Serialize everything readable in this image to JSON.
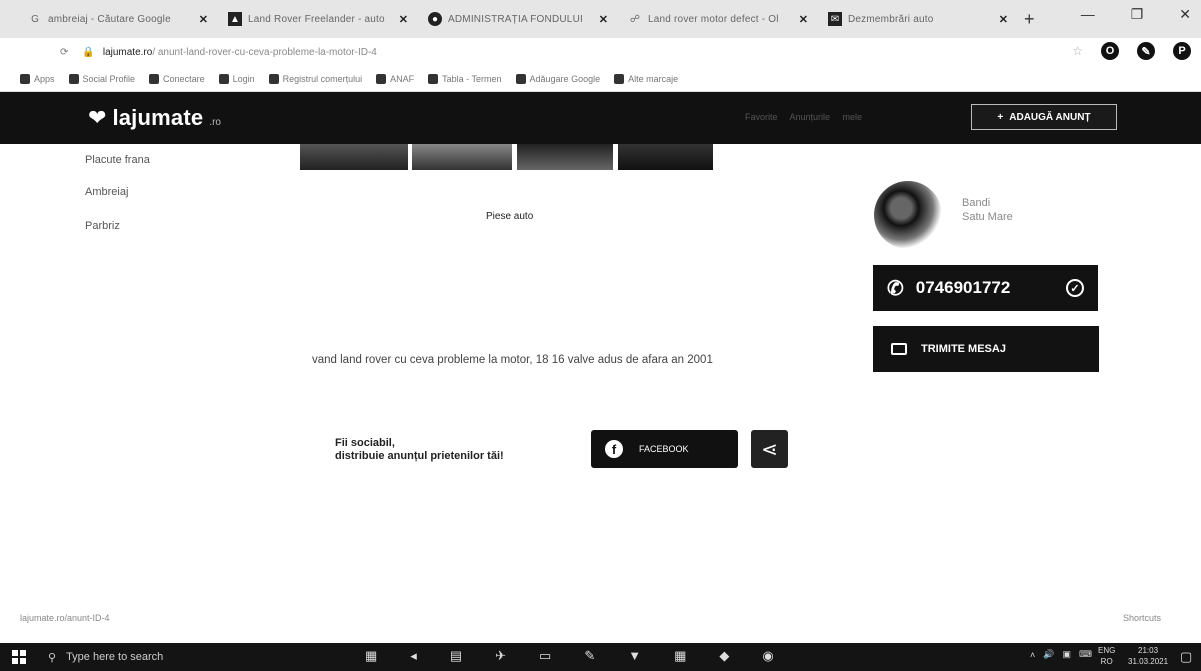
{
  "browser": {
    "tabs": [
      {
        "title": "ambreiaj - Căutare Google",
        "icon": "google-icon"
      },
      {
        "title": "Land Rover Freelander - auto",
        "icon": "site-icon"
      },
      {
        "title": "ADMINISTRAȚIA FONDULUI",
        "icon": "site-icon"
      },
      {
        "title": "Land rover motor defect - Ol",
        "icon": "site-icon"
      },
      {
        "title": "Dezmembrări auto",
        "icon": "site-icon"
      }
    ],
    "new_tab": "+",
    "url_domain": "lajumate.ro",
    "url_rest": "/ anunt-land-rover-cu-ceva-probleme-la-motor-ID-4",
    "bookmarks": [
      "Apps",
      "Social Profile",
      "Conectare",
      "Login",
      "Registrul comerțului",
      "ANAF",
      "Tabla - Termen",
      "Adăugare Google",
      "Alte marcaje"
    ],
    "profile_letter": "P"
  },
  "site": {
    "logo": "lajumate",
    "logo_tld": ".ro",
    "header_links": "Favorite   Anunțurile mele",
    "add_button": "ADAUGĂ ANUNȚ",
    "categories": [
      "Placute frana",
      "Ambreiaj",
      "Parbriz"
    ],
    "listing_category": "Piese auto",
    "seller_name": "Bandi",
    "seller_location": "Satu Mare",
    "phone": "0746901772",
    "send_message": "TRIMITE MESAJ",
    "description": "vand land rover cu ceva probleme la motor, 18 16 valve adus de afara an 2001",
    "social_line1": "Fii sociabil,",
    "social_line2": "distribuie anunțul prietenilor tăi!",
    "facebook_button": "FACEBOOK"
  },
  "status_bar": {
    "url": "lajumate.ro/anunt-ID-4",
    "right": "Shortcuts"
  },
  "taskbar": {
    "search_placeholder": "Type here to search",
    "lang_top": "ENG",
    "lang_bottom": "RO",
    "time": "21:03",
    "date": "31.03.2021"
  }
}
